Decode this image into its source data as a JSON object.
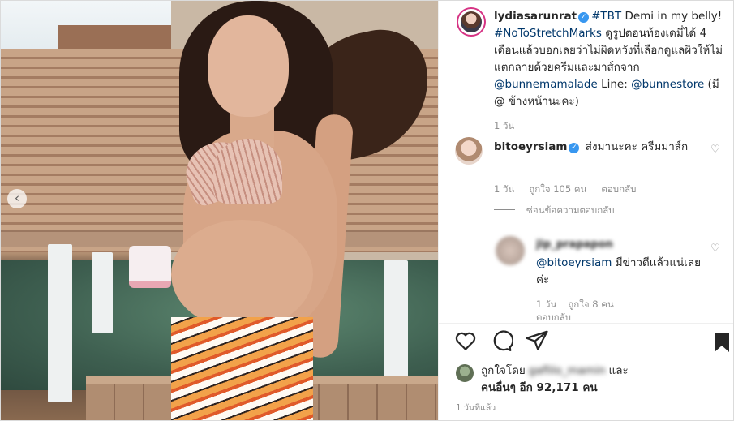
{
  "post": {
    "carousel_prev_glyph": "‹",
    "author": {
      "username": "lydiasarunrat",
      "verified_glyph": "✓"
    },
    "caption": {
      "hashtag_tbt": "#TBT",
      "text_1": " Demi in my belly! ",
      "hashtag_stretch": "#NoToStretchMarks",
      "text_2": " ดูรูปตอนท้องเดมี่ได้ 4 เดือนแล้วบอกเลยว่าไม่ผิดหวังที่เลือกดูแลผิวให้ไม่แตกลายด้วยครีมและมาส์กจาก ",
      "mention_1": "@bunnemamalade",
      "text_3": " Line: ",
      "mention_2": "@bunnestore",
      "text_4": " (มี @ ข้างหน้านะคะ)"
    },
    "caption_time": "1 วัน"
  },
  "comments": [
    {
      "username": "bitoeyrsiam",
      "text": "ส่งมานะคะ ครีมมาส์ก",
      "time": "1 วัน",
      "likes": "ถูกใจ 105 คน",
      "reply": "ตอบกลับ",
      "hide_replies": "ซ่อนข้อความตอบกลับ"
    },
    {
      "username": "jip_prapapon",
      "mention": "@bitoeyrsiam",
      "text": " มีข่าวดีแล้วแน่เลยค่ะ",
      "time": "1 วัน",
      "likes": "ถูกใจ 8 คน",
      "reply": "ตอบกลับ"
    }
  ],
  "footer": {
    "liked_by_prefix": "ถูกใจโดย",
    "liked_by_user": "gaflilo_mamin",
    "liked_by_and": "และ",
    "others": "คนอื่นๆ อีก 92,171 คน",
    "posted_ago": "1 วันที่แล้ว"
  },
  "icons": [
    "chevron-left-icon",
    "verified-badge-icon",
    "heart-icon",
    "comment-icon",
    "share-icon",
    "bookmark-icon"
  ],
  "colors": {
    "link": "#00376b",
    "verified": "#3897f0",
    "muted": "#8e8e8e"
  }
}
